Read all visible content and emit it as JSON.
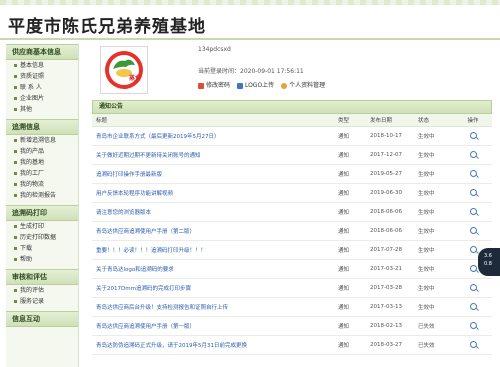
{
  "site": {
    "title": "平度市陈氏兄弟养殖基地"
  },
  "sidebar": {
    "sections": [
      {
        "title": "供应商基本信息",
        "items": [
          "基本信息",
          "资质证照",
          "联 系 人",
          "企业图片",
          "其他"
        ]
      },
      {
        "title": "追溯信息",
        "items": [
          "新增追溯信息",
          "我的产品",
          "我的基地",
          "我的工厂",
          "我的物流",
          "我的检测报告"
        ]
      },
      {
        "title": "追溯码打印",
        "items": [
          "生成打印",
          "历史打印数据",
          "下载",
          "帮助"
        ]
      },
      {
        "title": "审核和评估",
        "items": [
          "我的评估",
          "服务记录"
        ]
      },
      {
        "title": "信息互动",
        "items": []
      }
    ]
  },
  "user": {
    "logo_text": "蒸食",
    "username": "134pdcsxd",
    "last_login": "当前登录时间：2020-09-01 17:56:11",
    "links": [
      "修改密码",
      "LOGO上传",
      "个人资料管理"
    ]
  },
  "notice": {
    "title": "通知公告",
    "columns": [
      "标题",
      "类型",
      "发布日期",
      "状态",
      "操作"
    ],
    "rows": [
      {
        "title": "青岛市企业联系方式（最后更新2019年5月27日）",
        "type": "通知",
        "date": "2018-10-17",
        "status": "生效中"
      },
      {
        "title": "关于做好近期过期不更新待关闭账号的通知",
        "type": "通知",
        "date": "2017-12-07",
        "status": "生效中"
      },
      {
        "title": "追溯码打印操作手册最新版",
        "type": "通知",
        "date": "2019-05-27",
        "status": "生效中"
      },
      {
        "title": "用户反馈本轮程序功能讲解视频",
        "type": "通知",
        "date": "2019-06-30",
        "status": "生效中"
      },
      {
        "title": "请注意您的浏览器版本",
        "type": "通知",
        "date": "2018-06-06",
        "status": "生效中"
      },
      {
        "title": "青岛达供应商追溯使用户手册（第二版）",
        "type": "通知",
        "date": "2018-06-06",
        "status": "生效中"
      },
      {
        "title": "重要！！！必读！！！追溯码打印升级！！！",
        "type": "通知",
        "date": "2017-07-28",
        "status": "生效中"
      },
      {
        "title": "关于青岛达logo和追溯码的要求",
        "type": "通知",
        "date": "2017-03-21",
        "status": "生效中"
      },
      {
        "title": "关于2017Dmm追溯码的完成打印步骤",
        "type": "通知",
        "date": "2017-03-28",
        "status": "生效中"
      },
      {
        "title": "青岛达供应商后台升级！支持检测报告和证照自行上传",
        "type": "通知",
        "date": "2017-03-13",
        "status": "生效中"
      },
      {
        "title": "青岛达供应商追溯使用户手册（第一版）",
        "type": "通知",
        "date": "2018-02-13",
        "status": "已失效"
      },
      {
        "title": "青岛达防伪追溯码正式升级，请于2019年5月31日前完成更换",
        "type": "通知",
        "date": "2018-03-27",
        "status": "已失效"
      }
    ]
  },
  "badge": {
    "line1": "3.6",
    "line2": "0.8"
  },
  "colors": {
    "accent": "#6b8e3e",
    "link": "#2a5db0",
    "header_bg": "#cfe0b8"
  }
}
